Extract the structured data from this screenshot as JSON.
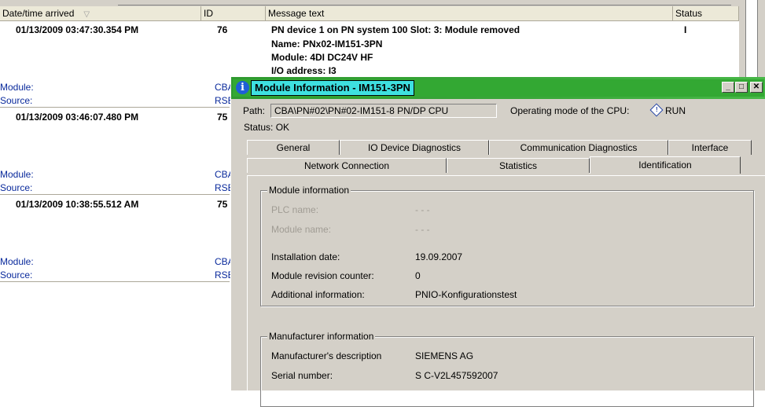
{
  "list": {
    "headers": {
      "datetime": "Date/time arrived",
      "id": "ID",
      "message": "Message text",
      "status": "Status"
    },
    "rows": [
      {
        "datetime": "01/13/2009 03:47:30.354 PM",
        "id": "76",
        "message_lines": [
          "PN device 1 on PN system 100 Slot: 3: Module removed",
          "Name: PNx02-IM151-3PN",
          "Module: 4DI DC24V HF",
          "I/O address: I3"
        ],
        "status": "I",
        "module_label": "Module:",
        "module_value": "CBA",
        "source_label": "Source:",
        "source_value": "RSE"
      },
      {
        "datetime": "01/13/2009 03:46:07.480 PM",
        "id": "75",
        "module_label": "Module:",
        "module_value": "CBA",
        "source_label": "Source:",
        "source_value": "RSE"
      },
      {
        "datetime": "01/13/2009 10:38:55.512 AM",
        "id": "75",
        "module_label": "Module:",
        "module_value": "CBA",
        "source_label": "Source:",
        "source_value": "RSE"
      }
    ]
  },
  "dialog": {
    "title": "Module Information - IM151-3PN",
    "path_label": "Path:",
    "path_value": "CBA\\PN#02\\PN#02-IM151-8 PN/DP CPU",
    "operating_mode_label": "Operating mode of the  CPU:",
    "operating_mode_value": "RUN",
    "status_text": "Status:  OK",
    "tabs_row1": [
      "General",
      "IO Device Diagnostics",
      "Communication Diagnostics",
      "Interface"
    ],
    "tabs_row2": [
      "Network Connection",
      "Statistics",
      "Identification"
    ],
    "module_info": {
      "title": "Module information",
      "plc_name_label": "PLC name:",
      "plc_name_value": "- - -",
      "module_name_label": "Module name:",
      "module_name_value": "- - -",
      "install_date_label": "Installation date:",
      "install_date_value": "19.09.2007",
      "revision_label": "Module revision counter:",
      "revision_value": "0",
      "additional_label": "Additional information:",
      "additional_value": "PNIO-Konfigurationstest"
    },
    "manufacturer_info": {
      "title": "Manufacturer information",
      "desc_label": "Manufacturer's description",
      "desc_value": "SIEMENS AG",
      "serial_label": "Serial number:",
      "serial_value": "S C-V2L457592007"
    }
  },
  "colors": {
    "title_bg": "#33a833",
    "title_text_bg": "#3ee0e0",
    "link_blue": "#0a2a9c"
  }
}
